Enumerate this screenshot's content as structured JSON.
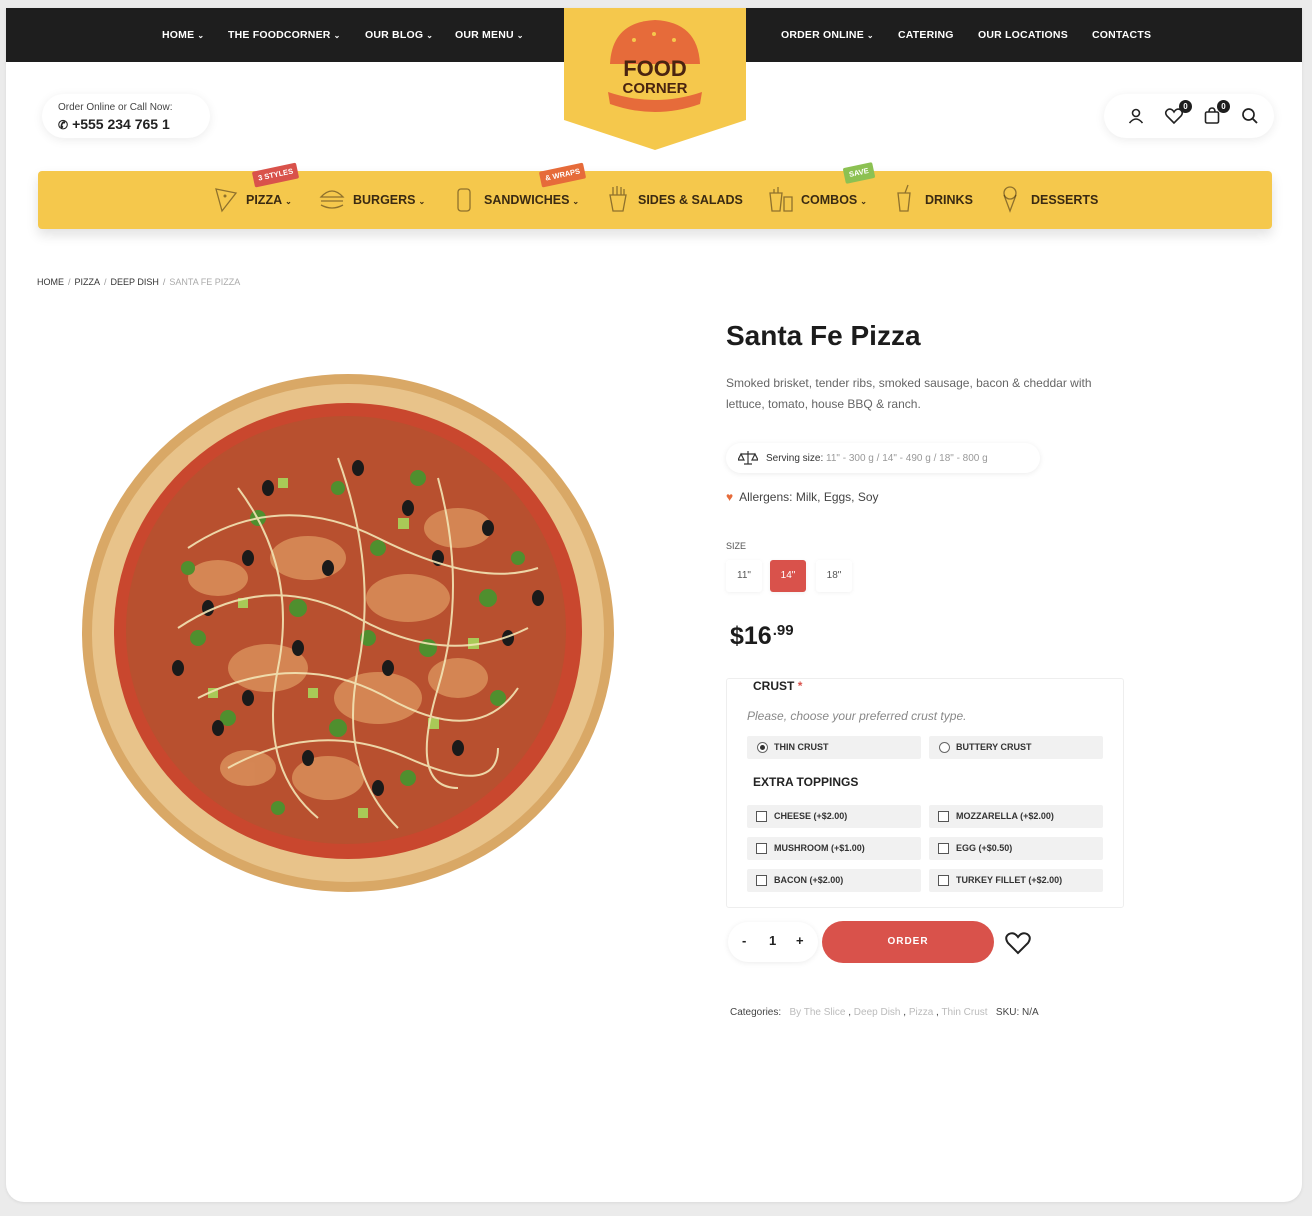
{
  "top_nav": {
    "left": [
      {
        "label": "HOME",
        "caret": true
      },
      {
        "label": "THE FOODCORNER",
        "caret": true
      },
      {
        "label": "OUR BLOG",
        "caret": true
      },
      {
        "label": "OUR MENU",
        "caret": true
      }
    ],
    "right": [
      {
        "label": "ORDER ONLINE",
        "caret": true
      },
      {
        "label": "CATERING",
        "caret": false
      },
      {
        "label": "OUR LOCATIONS",
        "caret": false
      },
      {
        "label": "CONTACTS",
        "caret": false
      }
    ]
  },
  "logo": {
    "line1": "FOOD",
    "line2": "CORNER"
  },
  "call": {
    "label": "Order Online or Call Now:",
    "phone": "+555 234 765 1"
  },
  "user_bar": {
    "wishlist_count": "0",
    "cart_count": "0"
  },
  "categories": [
    {
      "label": "PIZZA",
      "caret": true,
      "icon": "pizza-slice-icon",
      "tag": "3 STYLES",
      "tag_color": "#d9524b"
    },
    {
      "label": "BURGERS",
      "caret": true,
      "icon": "burger-icon"
    },
    {
      "label": "SANDWICHES",
      "caret": true,
      "icon": "sandwich-icon",
      "tag": "& WRAPS",
      "tag_color": "#e66b3a"
    },
    {
      "label": "SIDES & SALADS",
      "caret": false,
      "icon": "fries-icon"
    },
    {
      "label": "COMBOS",
      "caret": true,
      "icon": "combo-icon",
      "tag": "SAVE",
      "tag_color": "#8cc152"
    },
    {
      "label": "DRINKS",
      "caret": false,
      "icon": "drink-icon"
    },
    {
      "label": "DESSERTS",
      "caret": false,
      "icon": "ice-cream-icon"
    }
  ],
  "breadcrumbs": [
    "HOME",
    "PIZZA",
    "DEEP DISH",
    "SANTA FE PIZZA"
  ],
  "product": {
    "title": "Santa Fe Pizza",
    "description": "Smoked brisket, tender ribs, smoked sausage, bacon & cheddar with lettuce, tomato, house BBQ & ranch.",
    "serving_label": "Serving size:",
    "serving_value": "11\" - 300 g / 14\" - 490 g / 18\" - 800 g",
    "allergens": "Allergens: Milk, Eggs, Soy",
    "size_label": "SIZE",
    "sizes": [
      "11\"",
      "14\"",
      "18\""
    ],
    "selected_size": "14\"",
    "price_main": "$16",
    "price_cents": ".99",
    "crust_title": "CRUST",
    "crust_required": "*",
    "crust_hint": "Please, choose your preferred crust type.",
    "crust_options": [
      {
        "label": "THIN CRUST",
        "selected": true
      },
      {
        "label": "BUTTERY CRUST",
        "selected": false
      }
    ],
    "toppings_title": "EXTRA TOPPINGS",
    "toppings": [
      "CHEESE (+$2.00)",
      "MOZZARELLA (+$2.00)",
      "MUSHROOM (+$1.00)",
      "EGG (+$0.50)",
      "BACON (+$2.00)",
      "TURKEY FILLET (+$2.00)"
    ],
    "quantity": "1",
    "minus": "-",
    "plus": "+",
    "order_label": "ORDER",
    "categories_label": "Categories:",
    "category_links": [
      "By The Slice",
      "Deep Dish",
      "Pizza",
      "Thin Crust"
    ],
    "sku_label": "SKU:",
    "sku_value": "N/A"
  },
  "colors": {
    "accent_red": "#d9524b",
    "brand_yellow": "#f5c84c",
    "dark": "#1e1e1e"
  }
}
